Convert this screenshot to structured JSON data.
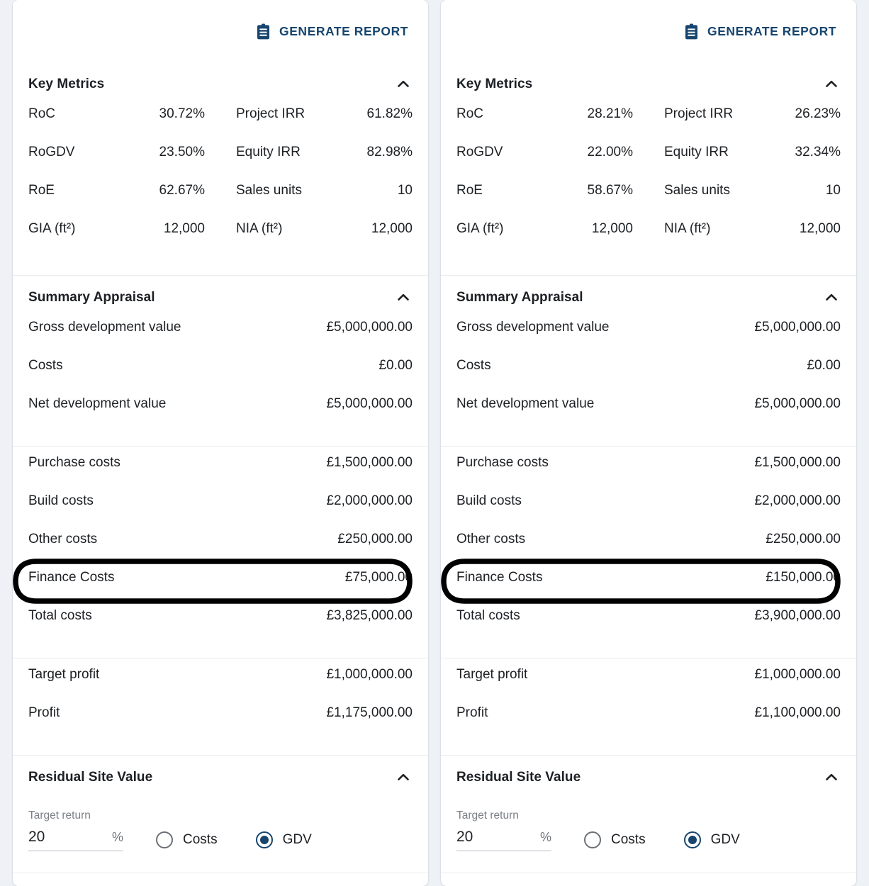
{
  "theme": {
    "accent": "#17456e",
    "page_bg": "#eef2f6",
    "card_bg": "#ffffff",
    "text": "#1d2024",
    "muted": "#7b7f85",
    "divider": "#e8ecef",
    "highlight_stroke": "#000000"
  },
  "panels": [
    {
      "id": "panel-left",
      "generate_report_label": "GENERATE REPORT",
      "generate_report_icon": "clipboard-icon",
      "key_metrics": {
        "title": "Key Metrics",
        "collapse_icon": "chevron-up-icon",
        "items": [
          {
            "label": "RoC",
            "value": "30.72%"
          },
          {
            "label": "Project IRR",
            "value": "61.82%"
          },
          {
            "label": "RoGDV",
            "value": "23.50%"
          },
          {
            "label": "Equity IRR",
            "value": "82.98%"
          },
          {
            "label": "RoE",
            "value": "62.67%"
          },
          {
            "label": "Sales units",
            "value": "10"
          },
          {
            "label": "GIA (ft²)",
            "value": "12,000"
          },
          {
            "label": "NIA (ft²)",
            "value": "12,000"
          }
        ]
      },
      "summary_appraisal": {
        "title": "Summary Appraisal",
        "collapse_icon": "chevron-up-icon",
        "value_rows": [
          {
            "label": "Gross development value",
            "value": "£5,000,000.00"
          },
          {
            "label": "Costs",
            "value": "£0.00"
          },
          {
            "label": "Net development value",
            "value": "£5,000,000.00"
          }
        ],
        "cost_rows": [
          {
            "label": "Purchase costs",
            "value": "£1,500,000.00",
            "highlighted": false
          },
          {
            "label": "Build costs",
            "value": "£2,000,000.00",
            "highlighted": false
          },
          {
            "label": "Other costs",
            "value": "£250,000.00",
            "highlighted": false
          },
          {
            "label": "Finance Costs",
            "value": "£75,000.00",
            "highlighted": true
          },
          {
            "label": "Total costs",
            "value": "£3,825,000.00",
            "highlighted": false
          }
        ],
        "profit_rows": [
          {
            "label": "Target profit",
            "value": "£1,000,000.00"
          },
          {
            "label": "Profit",
            "value": "£1,175,000.00"
          }
        ]
      },
      "residual_site_value": {
        "title": "Residual Site Value",
        "collapse_icon": "chevron-up-icon",
        "target_return_label": "Target return",
        "target_return_value": "20",
        "target_return_suffix": "%",
        "basis_options": [
          {
            "label": "Costs",
            "selected": false
          },
          {
            "label": "GDV",
            "selected": true
          }
        ]
      }
    },
    {
      "id": "panel-right",
      "generate_report_label": "GENERATE REPORT",
      "generate_report_icon": "clipboard-icon",
      "key_metrics": {
        "title": "Key Metrics",
        "collapse_icon": "chevron-up-icon",
        "items": [
          {
            "label": "RoC",
            "value": "28.21%"
          },
          {
            "label": "Project IRR",
            "value": "26.23%"
          },
          {
            "label": "RoGDV",
            "value": "22.00%"
          },
          {
            "label": "Equity IRR",
            "value": "32.34%"
          },
          {
            "label": "RoE",
            "value": "58.67%"
          },
          {
            "label": "Sales units",
            "value": "10"
          },
          {
            "label": "GIA (ft²)",
            "value": "12,000"
          },
          {
            "label": "NIA (ft²)",
            "value": "12,000"
          }
        ]
      },
      "summary_appraisal": {
        "title": "Summary Appraisal",
        "collapse_icon": "chevron-up-icon",
        "value_rows": [
          {
            "label": "Gross development value",
            "value": "£5,000,000.00"
          },
          {
            "label": "Costs",
            "value": "£0.00"
          },
          {
            "label": "Net development value",
            "value": "£5,000,000.00"
          }
        ],
        "cost_rows": [
          {
            "label": "Purchase costs",
            "value": "£1,500,000.00",
            "highlighted": false
          },
          {
            "label": "Build costs",
            "value": "£2,000,000.00",
            "highlighted": false
          },
          {
            "label": "Other costs",
            "value": "£250,000.00",
            "highlighted": false
          },
          {
            "label": "Finance Costs",
            "value": "£150,000.00",
            "highlighted": true
          },
          {
            "label": "Total costs",
            "value": "£3,900,000.00",
            "highlighted": false
          }
        ],
        "profit_rows": [
          {
            "label": "Target profit",
            "value": "£1,000,000.00"
          },
          {
            "label": "Profit",
            "value": "£1,100,000.00"
          }
        ]
      },
      "residual_site_value": {
        "title": "Residual Site Value",
        "collapse_icon": "chevron-up-icon",
        "target_return_label": "Target return",
        "target_return_value": "20",
        "target_return_suffix": "%",
        "basis_options": [
          {
            "label": "Costs",
            "selected": false
          },
          {
            "label": "GDV",
            "selected": true
          }
        ]
      }
    }
  ]
}
